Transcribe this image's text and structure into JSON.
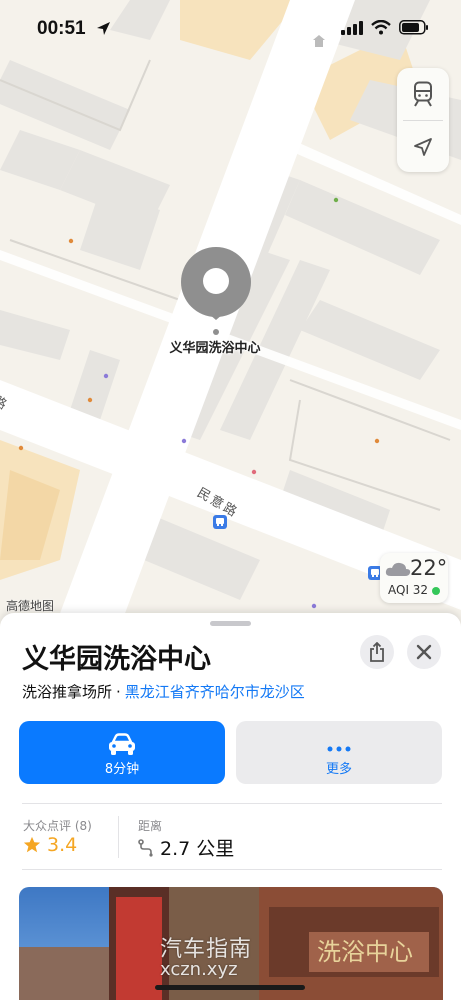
{
  "status_bar": {
    "time": "00:51"
  },
  "map": {
    "place_label": "义华园洗浴中心",
    "road_main": "民意路",
    "road_side": "路",
    "credit": "高德地图",
    "weather": {
      "temperature": "22°",
      "aqi": "AQI 32"
    }
  },
  "sheet": {
    "title": "义华园洗浴中心",
    "category": "洗浴推拿场所",
    "separator": "·",
    "region": "黑龙江省齐齐哈尔市龙沙区",
    "primary_action": {
      "label": "8分钟",
      "icon": "car-icon"
    },
    "secondary_action": {
      "label": "更多",
      "icon": "more-icon"
    },
    "rating": {
      "label": "大众点评 (8)",
      "value": "3.4"
    },
    "distance": {
      "label": "距离",
      "value": "2.7 公里"
    },
    "photo": {
      "watermark": "汽车指南",
      "watermark_sub": "xczn.xyz",
      "sign": "洗浴中心"
    }
  },
  "colors": {
    "accent": "#0a7aff",
    "link": "#1479f5",
    "star": "#f5a623",
    "aqi_good": "#34c759"
  }
}
